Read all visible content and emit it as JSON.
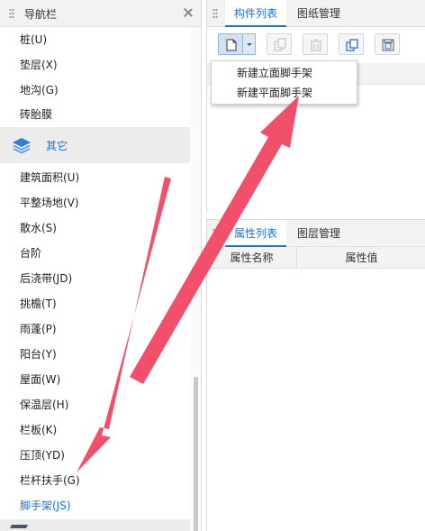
{
  "nav": {
    "title": "导航栏",
    "items_top": [
      "桩(U)",
      "垫层(X)",
      "地沟(G)",
      "砖胎膜"
    ],
    "category": "其它",
    "items": [
      "建筑面积(U)",
      "平整场地(V)",
      "散水(S)",
      "台阶",
      "后浇带(JD)",
      "挑檐(T)",
      "雨蓬(P)",
      "阳台(Y)",
      "屋面(W)",
      "保温层(H)",
      "栏板(K)",
      "压顶(YD)",
      "栏杆扶手(G)",
      "脚手架(JS)"
    ],
    "active_item": "脚手架(JS)"
  },
  "top_panel": {
    "tabs": [
      "构件列表",
      "图纸管理"
    ],
    "active_tab": "构件列表"
  },
  "dropdown": {
    "items": [
      "新建立面脚手架",
      "新建平面脚手架"
    ]
  },
  "bottom_panel": {
    "tabs": [
      "属性列表",
      "图层管理"
    ],
    "active_tab": "属性列表",
    "columns": [
      "属性名称",
      "属性值"
    ]
  },
  "colors": {
    "accent": "#1e6fd9",
    "arrow": "#f2506a"
  }
}
